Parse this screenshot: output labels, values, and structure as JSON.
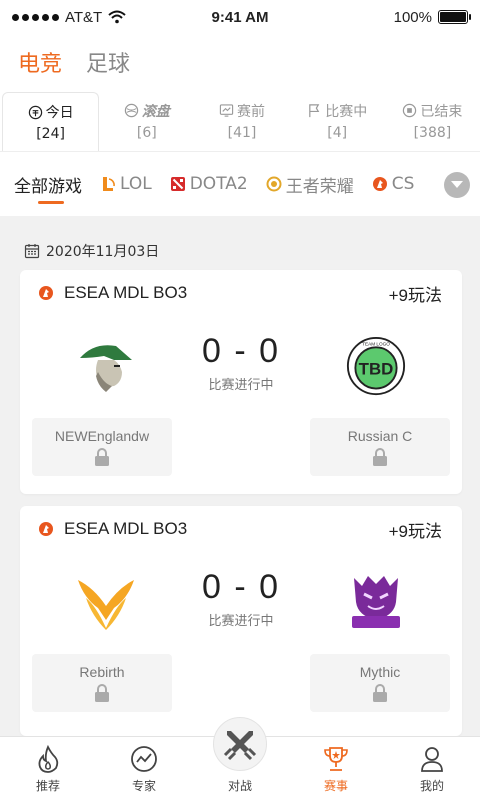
{
  "status_bar": {
    "carrier": "AT&T",
    "time": "9:41 AM",
    "battery": "100%"
  },
  "sport_tabs": [
    {
      "label": "电竞",
      "active": true
    },
    {
      "label": "足球",
      "active": false
    }
  ],
  "status_tabs": [
    {
      "label": "今日",
      "count": "[24]",
      "icon": "today-icon",
      "active": true
    },
    {
      "label": "滚盘",
      "count": "[6]",
      "icon": "rolling-icon",
      "active": false
    },
    {
      "label": "赛前",
      "count": "[41]",
      "icon": "pre-match-icon",
      "active": false
    },
    {
      "label": "比赛中",
      "count": "[4]",
      "icon": "in-play-flag-icon",
      "active": false
    },
    {
      "label": "已结束",
      "count": "[388]",
      "icon": "finished-icon",
      "active": false
    }
  ],
  "games": [
    {
      "label": "全部游戏",
      "active": true
    },
    {
      "label": "LOL",
      "icon": "lol-icon",
      "color": "#f08b1c"
    },
    {
      "label": "DOTA2",
      "icon": "dota2-icon",
      "color": "#d62b2b"
    },
    {
      "label": "王者荣耀",
      "icon": "honor-of-kings-icon",
      "color": "#e2a72a"
    },
    {
      "label": "CS",
      "icon": "cs-icon",
      "color": "#e8561e"
    }
  ],
  "date": "2020年11月03日",
  "matches": [
    {
      "league": "ESEA MDL BO3",
      "more": "+9玩法",
      "score": "0 - 0",
      "status": "比赛进行中",
      "team_left": "NEWEnglandw",
      "team_right": "Russian C"
    },
    {
      "league": "ESEA MDL BO3",
      "more": "+9玩法",
      "score": "0 - 0",
      "status": "比赛进行中",
      "team_left": "Rebirth",
      "team_right": "Mythic"
    }
  ],
  "bottom_nav": [
    {
      "label": "推荐",
      "icon": "flame-icon"
    },
    {
      "label": "专家",
      "icon": "trend-icon"
    },
    {
      "label": "对战",
      "icon": "crossed-swords-icon"
    },
    {
      "label": "赛事",
      "icon": "trophy-icon",
      "active": true
    },
    {
      "label": "我的",
      "icon": "user-icon"
    }
  ],
  "colors": {
    "accent": "#ee6a20",
    "background": "#f1f1f1"
  }
}
